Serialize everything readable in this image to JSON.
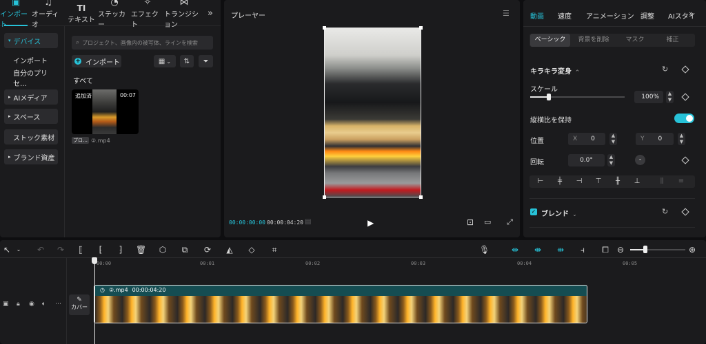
{
  "top_tabs": [
    {
      "label": "インポート",
      "icon": "import-icon",
      "glyph": "▣"
    },
    {
      "label": "オーディオ",
      "icon": "audio-icon",
      "glyph": "♫"
    },
    {
      "label": "テキスト",
      "icon": "text-icon",
      "glyph": "TI"
    },
    {
      "label": "ステッカー",
      "icon": "sticker-icon",
      "glyph": "◔"
    },
    {
      "label": "エフェクト",
      "icon": "effect-icon",
      "glyph": "✧"
    },
    {
      "label": "トランジション",
      "icon": "transition-icon",
      "glyph": "⋈"
    }
  ],
  "top_tabs_more": "»",
  "left_nav": {
    "device": "デバイス",
    "import": "インポート",
    "presets": "自分のプリセ…",
    "ai_media": "AIメディア",
    "space": "スペース",
    "stock": "ストック素材",
    "brand": "ブランド資産"
  },
  "media": {
    "search_placeholder": "プロジェクト、画像内の被写体、ラインを検索",
    "import_label": "インポート",
    "section_title": "すべて",
    "thumb_added": "追加済",
    "thumb_duration": "00:07",
    "thumb_tag": "プロ…",
    "thumb_filename": "②.mp4"
  },
  "player": {
    "title": "プレーヤー",
    "time_current": "00:00:00:00",
    "time_total": "00:00:04:20"
  },
  "right": {
    "tabs": [
      "動画",
      "速度",
      "アニメーション",
      "調整",
      "AIスタイ"
    ],
    "subtabs": [
      "ベーシック",
      "背景を削除",
      "マスク",
      "補正"
    ],
    "section_title": "キラキラ変身",
    "scale_label": "スケール",
    "scale_value": "100%",
    "scale_level_percent": 20,
    "keep_ratio_label": "縦横比を保持",
    "position_label": "位置",
    "pos_x_label": "X",
    "pos_x": "0",
    "pos_y_label": "Y",
    "pos_y": "0",
    "rotate_label": "回転",
    "rotate_value": "0.0°",
    "blend_label": "ブレンド"
  },
  "timeline": {
    "ticks": [
      "00:00",
      "00:01",
      "00:02",
      "00:03",
      "00:04",
      "00:05"
    ],
    "clip_name": "②.mp4",
    "clip_duration": "00:00:04:20",
    "cover_label": "カバー",
    "zoom_level_percent": 28
  },
  "colors": {
    "accent": "#27c2d8",
    "panel": "#1b1b1d",
    "clip": "#154d52"
  }
}
